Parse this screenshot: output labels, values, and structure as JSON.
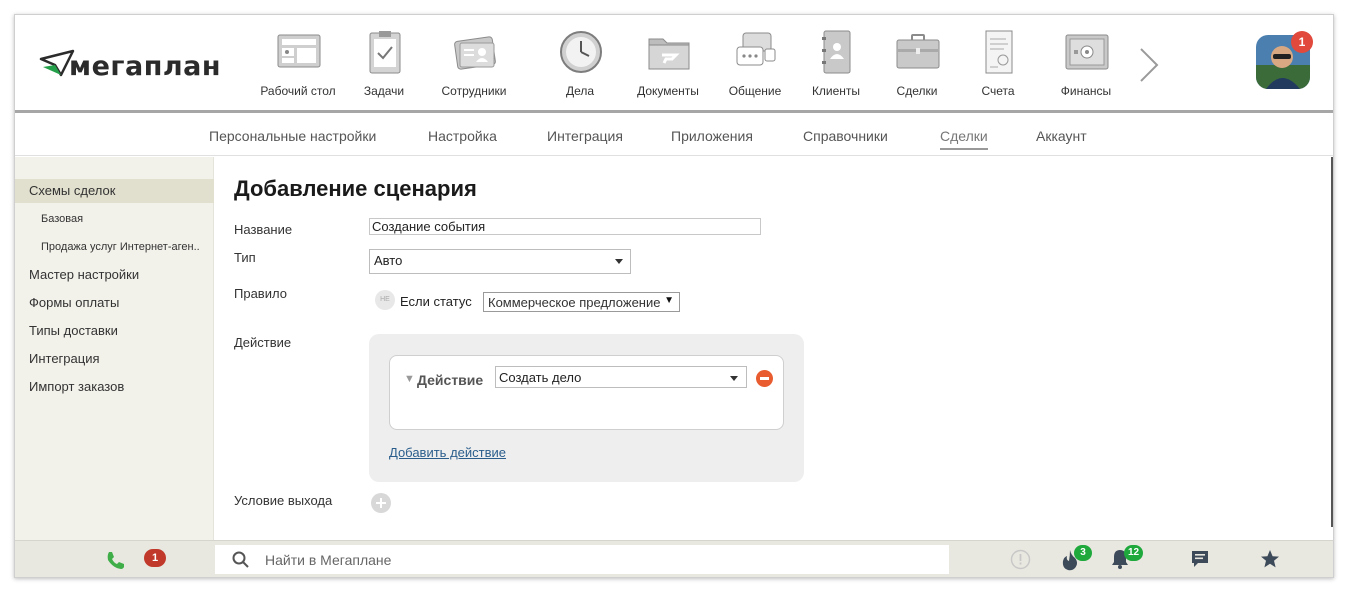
{
  "app": {
    "logo_text": "мегаплан"
  },
  "modules": [
    {
      "label": "Рабочий стол",
      "icon": "desktop-icon"
    },
    {
      "label": "Задачи",
      "icon": "tasks-clipboard-icon"
    },
    {
      "label": "Сотрудники",
      "icon": "employees-card-icon"
    },
    {
      "label": "Дела",
      "icon": "clock-icon"
    },
    {
      "label": "Документы",
      "icon": "folder-icon"
    },
    {
      "label": "Общение",
      "icon": "chat-bubbles-icon"
    },
    {
      "label": "Клиенты",
      "icon": "contacts-book-icon"
    },
    {
      "label": "Сделки",
      "icon": "briefcase-icon"
    },
    {
      "label": "Счета",
      "icon": "invoice-icon"
    },
    {
      "label": "Финансы",
      "icon": "safe-icon"
    }
  ],
  "user": {
    "notifications_count": "1"
  },
  "tabs": [
    {
      "label": "Персональные настройки",
      "active": false
    },
    {
      "label": "Настройка",
      "active": false
    },
    {
      "label": "Интеграция",
      "active": false
    },
    {
      "label": "Приложения",
      "active": false
    },
    {
      "label": "Справочники",
      "active": false
    },
    {
      "label": "Сделки",
      "active": true
    },
    {
      "label": "Аккаунт",
      "active": false
    }
  ],
  "sidebar": {
    "items": [
      {
        "label": "Схемы сделок",
        "active": true,
        "sub": false
      },
      {
        "label": "Базовая",
        "active": false,
        "sub": true
      },
      {
        "label": "Продажа услуг Интернет-аген..",
        "active": false,
        "sub": true
      },
      {
        "label": "Мастер настройки",
        "active": false,
        "sub": false
      },
      {
        "label": "Формы оплаты",
        "active": false,
        "sub": false
      },
      {
        "label": "Типы доставки",
        "active": false,
        "sub": false
      },
      {
        "label": "Интеграция",
        "active": false,
        "sub": false
      },
      {
        "label": "Импорт заказов",
        "active": false,
        "sub": false
      }
    ]
  },
  "form": {
    "title": "Добавление сценария",
    "name_label": "Название",
    "name_value": "Создание события",
    "type_label": "Тип",
    "type_value": "Авто",
    "rule_label": "Правило",
    "rule_not_toggle": "НЕ",
    "rule_text": "Если статус",
    "rule_status_value": "Коммерческое предложение",
    "action_label": "Действие",
    "action_item_label": "Действие",
    "action_value": "Создать дело",
    "add_action_link": "Добавить действие",
    "exit_condition_label": "Условие выхода"
  },
  "bottombar": {
    "missed_calls": "1",
    "search_placeholder": "Найти в Мегаплане",
    "hot_count": "3",
    "bell_count": "12"
  },
  "colors": {
    "accent_green": "#1fa93d",
    "alert_red": "#e0493b",
    "remove_orange": "#e85c2f",
    "link_blue": "#2a5d8c"
  }
}
